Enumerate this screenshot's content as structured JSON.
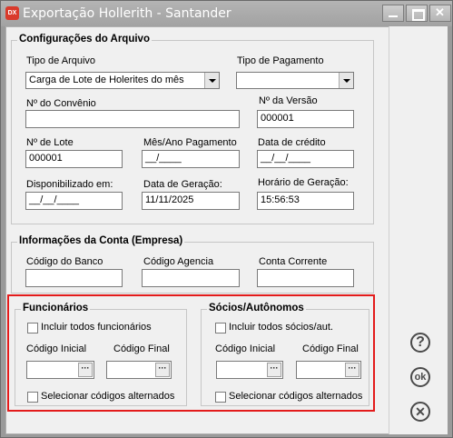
{
  "window": {
    "app_icon": "DX",
    "title": "Exportação Hollerith  - Santander",
    "close_glyph": "✕"
  },
  "config": {
    "title": "Configurações do Arquivo",
    "tipo_arquivo_label": "Tipo de Arquivo",
    "tipo_arquivo_value": "Carga de Lote de Holerites do mês",
    "tipo_pagamento_label": "Tipo de Pagamento",
    "tipo_pagamento_value": "",
    "convenio_label": "Nº do Convênio",
    "convenio_value": "",
    "versao_label": "Nº da Versão",
    "versao_value": "000001",
    "lote_label": "Nº de Lote",
    "lote_value": "000001",
    "mes_ano_label": "Mês/Ano Pagamento",
    "mes_ano_value": "__/____",
    "data_credito_label": "Data de crédito",
    "data_credito_value": "__/__/____",
    "disponibilizado_label": "Disponibilizado em:",
    "disponibilizado_value": "__/__/____",
    "data_geracao_label": "Data de Geração:",
    "data_geracao_value": "11/11/2025",
    "horario_geracao_label": "Horário de Geração:",
    "horario_geracao_value": "15:56:53"
  },
  "conta": {
    "title": "Informações da Conta (Empresa)",
    "banco_label": "Código do Banco",
    "agencia_label": "Código Agencia",
    "corrente_label": "Conta Corrente",
    "banco_value": "",
    "agencia_value": "",
    "corrente_value": ""
  },
  "funcionarios": {
    "title": "Funcionários",
    "incluir_label": "Incluir todos funcionários",
    "codigo_inicial_label": "Código Inicial",
    "codigo_final_label": "Código Final",
    "alternados_label": "Selecionar códigos alternados",
    "lookup_glyph": "···"
  },
  "socios": {
    "title": "Sócios/Autônomos",
    "incluir_label": "Incluir todos sócios/aut.",
    "codigo_inicial_label": "Código Inicial",
    "codigo_final_label": "Código Final",
    "alternados_label": "Selecionar códigos alternados"
  },
  "sidebar": {
    "help_glyph": "?",
    "ok_glyph": "ok",
    "cancel_glyph": "✕"
  },
  "colors": {
    "highlight": "#e31b1b",
    "titlebar": "#a8a8a8",
    "panel": "#f0f0f0"
  }
}
